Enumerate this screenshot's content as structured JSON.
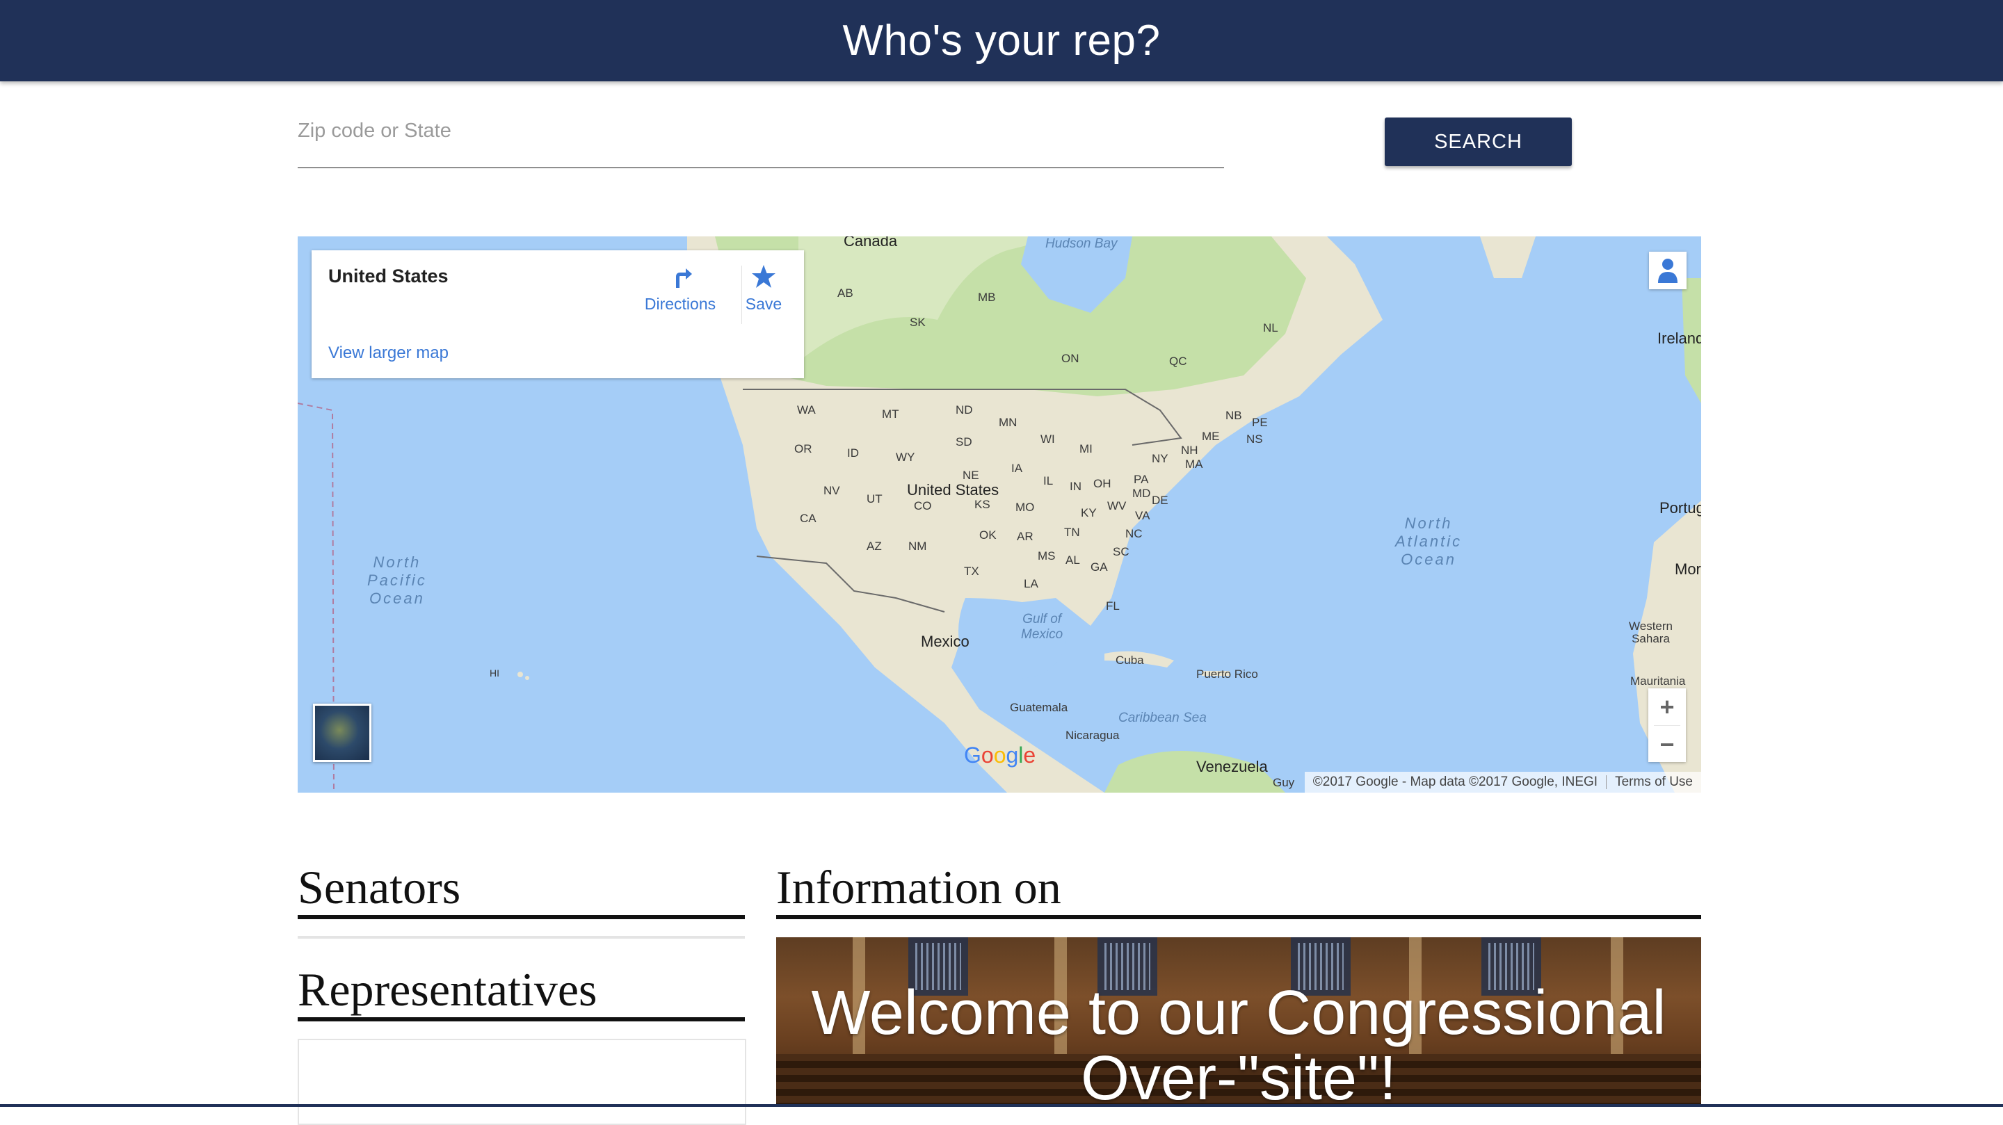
{
  "header": {
    "title": "Who's your rep?"
  },
  "search": {
    "placeholder": "Zip code or State",
    "value": "",
    "button_label": "SEARCH"
  },
  "map": {
    "info_card": {
      "place_name": "United States",
      "directions_label": "Directions",
      "save_label": "Save",
      "view_larger_label": "View larger map"
    },
    "labels": {
      "canada": "Canada",
      "hudson_bay": "Hudson Bay",
      "ab": "AB",
      "mb": "MB",
      "sk": "SK",
      "on": "ON",
      "qc": "QC",
      "nl": "NL",
      "ireland": "Ireland",
      "wa": "WA",
      "mt": "MT",
      "nd": "ND",
      "mn": "MN",
      "nb": "NB",
      "pe": "PE",
      "ns": "NS",
      "me": "ME",
      "or": "OR",
      "id": "ID",
      "wy": "WY",
      "sd": "SD",
      "wi": "WI",
      "mi": "MI",
      "ny": "NY",
      "nh": "NH",
      "ma": "MA",
      "ne": "NE",
      "ia": "IA",
      "united_states": "United States",
      "nv": "NV",
      "ut": "UT",
      "co": "CO",
      "ks": "KS",
      "mo": "MO",
      "il": "IL",
      "in": "IN",
      "oh": "OH",
      "pa": "PA",
      "md": "MD",
      "de": "DE",
      "wv": "WV",
      "va": "VA",
      "ky": "KY",
      "ca": "CA",
      "ok": "OK",
      "ar": "AR",
      "tn": "TN",
      "nc": "NC",
      "sc": "SC",
      "az": "AZ",
      "nm": "NM",
      "tx": "TX",
      "ms": "MS",
      "al": "AL",
      "ga": "GA",
      "la": "LA",
      "fl": "FL",
      "portugal": "Portug",
      "mor": "Mor",
      "north_pacific": "North\nPacific\nOcean",
      "north_atlantic": "North\nAtlantic\nOcean",
      "gulf": "Gulf of\nMexico",
      "mexico": "Mexico",
      "cuba": "Cuba",
      "puerto_rico": "Puerto Rico",
      "guatemala": "Guatemala",
      "caribbean": "Caribbean Sea",
      "nicaragua": "Nicaragua",
      "venezuela": "Venezuela",
      "western_sahara": "Western\nSahara",
      "mauritania": "Mauritania",
      "hi": "HI",
      "guy": "Guy"
    },
    "zoom_in": "+",
    "zoom_out": "−",
    "google_logo": "Google",
    "attribution": "©2017 Google - Map data ©2017 Google, INEGI",
    "terms": "Terms of Use",
    "colors": {
      "water": "#a5cdf7",
      "land": "#e9e5d2",
      "green": "#c5e0a8"
    }
  },
  "senators": {
    "heading": "Senators"
  },
  "representatives": {
    "heading": "Representatives"
  },
  "information": {
    "heading": "Information on",
    "banner_title": "Welcome to our Congressional Over-\"site\"!"
  },
  "colors": {
    "navy": "#203158",
    "link_blue": "#3a78d6"
  }
}
